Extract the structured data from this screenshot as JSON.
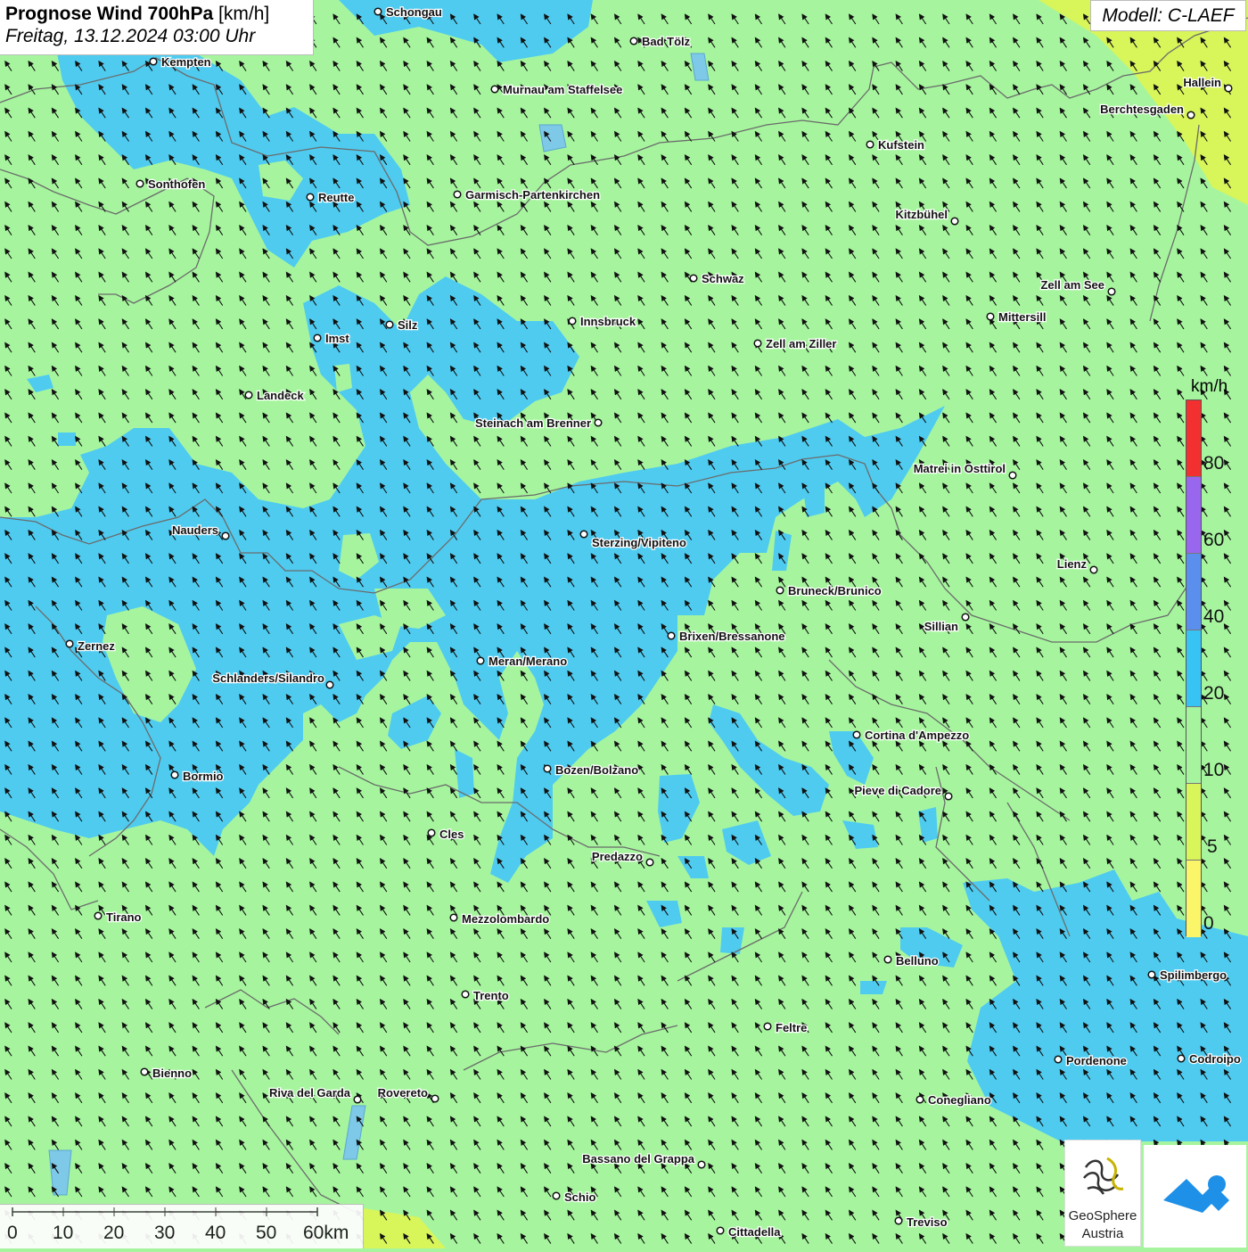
{
  "header": {
    "title_bold": "Prognose Wind 700hPa",
    "title_unit": "[km/h]",
    "datetime": "Freitag, 13.12.2024 03:00 Uhr"
  },
  "model": "Modell: C-LAEF",
  "legend": {
    "unit": "km/h",
    "labels": [
      "80",
      "60",
      "40",
      "20",
      "10",
      "5",
      "0"
    ],
    "colors": [
      "#f23030",
      "#9966ee",
      "#5b8fee",
      "#38c3f5",
      "#a6f59e",
      "#d8f55a",
      "#fbf56a"
    ]
  },
  "scale_bar": {
    "labels": [
      "0",
      "10",
      "20",
      "30",
      "40",
      "50",
      "60km"
    ]
  },
  "colors": {
    "wind_0_5": "#fbf56a",
    "wind_5_10": "#d8f55a",
    "wind_10_20": "#a6f59e",
    "wind_20_40": "#4fcbf0",
    "border": "#6b6b6b",
    "lake": "#7ec8e8"
  },
  "wind_direction": "from south-east (arrows point north-west)",
  "cities": [
    {
      "name": "Schongau"
    },
    {
      "name": "Bad Tölz"
    },
    {
      "name": "Kempten"
    },
    {
      "name": "Hallein"
    },
    {
      "name": "Murnau am Staffelsee"
    },
    {
      "name": "Berchtesgaden"
    },
    {
      "name": "Kufstein"
    },
    {
      "name": "Sonthofen"
    },
    {
      "name": "Reutte"
    },
    {
      "name": "Garmisch-Partenkirchen"
    },
    {
      "name": "Kitzbühel"
    },
    {
      "name": "Schwaz"
    },
    {
      "name": "Zell am See"
    },
    {
      "name": "Mittersill"
    },
    {
      "name": "Silz"
    },
    {
      "name": "Innsbruck"
    },
    {
      "name": "Imst"
    },
    {
      "name": "Zell am Ziller"
    },
    {
      "name": "Landeck"
    },
    {
      "name": "Steinach am Brenner"
    },
    {
      "name": "Matrei in Osttirol"
    },
    {
      "name": "Nauders"
    },
    {
      "name": "Sterzing/Vipiteno"
    },
    {
      "name": "Lienz"
    },
    {
      "name": "Bruneck/Brunico"
    },
    {
      "name": "Sillian"
    },
    {
      "name": "Brixen/Bressanone"
    },
    {
      "name": "Zernez"
    },
    {
      "name": "Meran/Merano"
    },
    {
      "name": "Schlanders/Silandro"
    },
    {
      "name": "Cortina d'Ampezzo"
    },
    {
      "name": "Bozen/Bolzano"
    },
    {
      "name": "Bormio"
    },
    {
      "name": "Pieve di Cadore"
    },
    {
      "name": "Cles"
    },
    {
      "name": "Predazzo"
    },
    {
      "name": "Tirano"
    },
    {
      "name": "Mezzolombardo"
    },
    {
      "name": "Belluno"
    },
    {
      "name": "Spilimbergo"
    },
    {
      "name": "Trento"
    },
    {
      "name": "Feltre"
    },
    {
      "name": "Bienno"
    },
    {
      "name": "Pordenone"
    },
    {
      "name": "Codroipo"
    },
    {
      "name": "Riva del Garda"
    },
    {
      "name": "Rovereto"
    },
    {
      "name": "Conegliano"
    },
    {
      "name": "Bassano del Grappa"
    },
    {
      "name": "Schio"
    },
    {
      "name": "Treviso"
    },
    {
      "name": "Cittadella"
    }
  ],
  "logos": {
    "geosphere_name": "GeoSphere",
    "geosphere_sub": "Austria"
  }
}
